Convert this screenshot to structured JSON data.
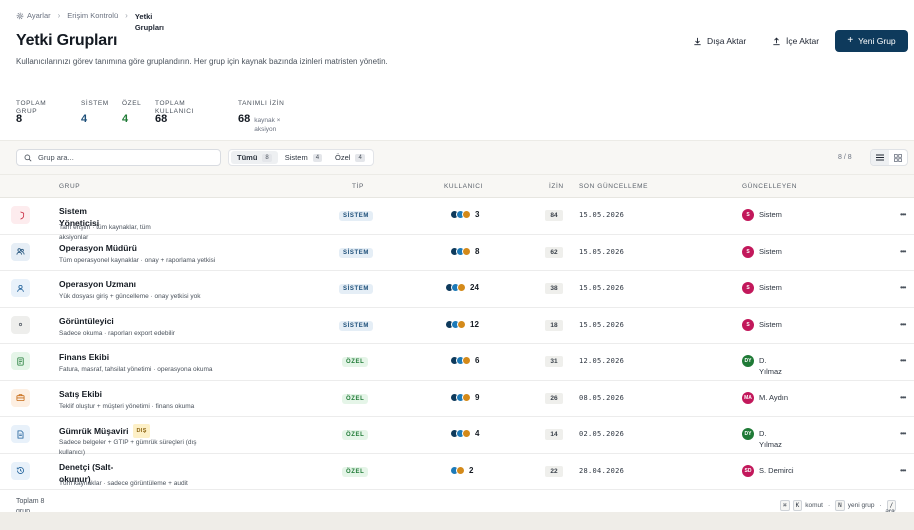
{
  "breadcrumb": {
    "items": [
      "Ayarlar",
      "Erişim Kontrolü"
    ],
    "current": "Yetki Grupları"
  },
  "page": {
    "title": "Yetki Grupları",
    "description": "Kullanıcılarınızı görev tanımına göre gruplandırın. Her grup için kaynak bazında izinleri matristen yönetin."
  },
  "actions": {
    "export": "Dışa Aktar",
    "import": "İçe Aktar",
    "new_group": "Yeni Grup"
  },
  "stats": {
    "total_groups": {
      "label": "TOPLAM GRUP",
      "value": "8"
    },
    "system": {
      "label": "SİSTEM",
      "value": "4"
    },
    "custom": {
      "label": "ÖZEL",
      "value": "4"
    },
    "total_users": {
      "label": "TOPLAM KULLANICI",
      "value": "68"
    },
    "defined_perms": {
      "label": "TANIMLI İZİN",
      "value": "68",
      "sub": "kaynak × aksiyon"
    }
  },
  "toolbar": {
    "search_placeholder": "Grup ara...",
    "filters": [
      {
        "label": "Tümü",
        "count": "8"
      },
      {
        "label": "Sistem",
        "count": "4"
      },
      {
        "label": "Özel",
        "count": "4"
      }
    ],
    "pager": "8 / 8"
  },
  "table": {
    "headers": {
      "group": "GRUP",
      "type": "TİP",
      "users": "KULLANICI",
      "perms": "İZİN",
      "last_update": "SON GÜNCELLEME",
      "updated_by": "GÜNCELLEYEN"
    },
    "rows": [
      {
        "name": "Sistem Yöneticisi",
        "desc": "Tam erişim · tüm kaynaklar, tüm aksiyonlar",
        "type": "SİSTEM",
        "users": "3",
        "perms": "84",
        "date": "15.05.2026",
        "by": "Sistem",
        "initials": "S",
        "icon": "shield-icon",
        "icon_color": "#c8283f",
        "icon_bg": "#fdecee"
      },
      {
        "name": "Operasyon Müdürü",
        "desc": "Tüm operasyonel kaynaklar · onay + raporlama yetkisi",
        "type": "SİSTEM",
        "users": "8",
        "perms": "62",
        "date": "15.05.2026",
        "by": "Sistem",
        "initials": "S",
        "icon": "users-icon",
        "icon_color": "#1d4f79",
        "icon_bg": "#e6eef6"
      },
      {
        "name": "Operasyon Uzmanı",
        "desc": "Yük dosyası giriş + güncelleme · onay yetkisi yok",
        "type": "SİSTEM",
        "users": "24",
        "perms": "38",
        "date": "15.05.2026",
        "by": "Sistem",
        "initials": "S",
        "icon": "user-icon",
        "icon_color": "#1d5f99",
        "icon_bg": "#e8f1fa"
      },
      {
        "name": "Görüntüleyici",
        "desc": "Sadece okuma · raporları export edebilir",
        "type": "SİSTEM",
        "users": "12",
        "perms": "18",
        "date": "15.05.2026",
        "by": "Sistem",
        "initials": "S",
        "icon": "eye-icon",
        "icon_color": "#5b626b",
        "icon_bg": "#eeeeec"
      },
      {
        "name": "Finans Ekibi",
        "desc": "Fatura, masraf, tahsilat yönetimi · operasyona okuma",
        "type": "ÖZEL",
        "users": "6",
        "perms": "31",
        "date": "12.05.2026",
        "by": "D. Yılmaz",
        "initials": "DY",
        "icon": "receipt-icon",
        "icon_color": "#1f7a36",
        "icon_bg": "#e5f5e8"
      },
      {
        "name": "Satış Ekibi",
        "desc": "Teklif oluştur + müşteri yönetimi · finans okuma",
        "type": "ÖZEL",
        "users": "9",
        "perms": "26",
        "date": "08.05.2026",
        "by": "M. Aydın",
        "initials": "MA",
        "icon": "briefcase-icon",
        "icon_color": "#c66a14",
        "icon_bg": "#fdefe2"
      },
      {
        "name": "Gümrük Müşaviri",
        "tag": "DIŞ",
        "desc": "Sadece belgeler + GTIP + gümrük süreçleri (dış kullanıcı)",
        "type": "ÖZEL",
        "users": "4",
        "perms": "14",
        "date": "02.05.2026",
        "by": "D. Yılmaz",
        "initials": "DY",
        "icon": "document-icon",
        "icon_color": "#1d5f99",
        "icon_bg": "#e8f1fa"
      },
      {
        "name": "Denetçi (Salt-okunur)",
        "desc": "Tüm kaynaklar · sadece görüntüleme + audit",
        "type": "ÖZEL",
        "users": "2",
        "perms": "22",
        "date": "28.04.2026",
        "by": "S. Demirci",
        "initials": "SD",
        "icon": "history-icon",
        "icon_color": "#1d5f99",
        "icon_bg": "#e8f1fa"
      }
    ]
  },
  "footer": {
    "total": "Toplam 8 grup",
    "shortcuts": [
      {
        "keys": [
          "⌘",
          "K"
        ],
        "label": "komut"
      },
      {
        "keys": [
          "N"
        ],
        "label": "yeni grup"
      },
      {
        "keys": [
          "/"
        ],
        "label": "ara"
      }
    ]
  },
  "colors": {
    "primary": "#0e3a5c",
    "system_badge": "#1d4f79",
    "custom_badge": "#1f7a36",
    "avatar_system": "#c2185b",
    "avatar_dy": "#1f7a36",
    "avatar_ma": "#c2185b",
    "avatar_sd": "#c2185b",
    "user_dot_1": "#0e3a5c",
    "user_dot_2": "#1d7ab8",
    "user_dot_3": "#d48a1a"
  }
}
